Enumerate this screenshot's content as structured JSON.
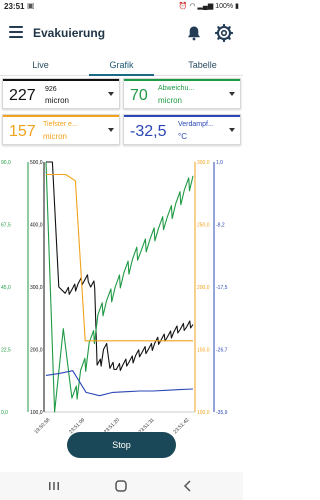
{
  "status": {
    "time": "23:51",
    "battery": "100%",
    "notification_icon": "image-icon"
  },
  "appbar": {
    "title": "Evakuierung"
  },
  "tabs": [
    {
      "label": "Live",
      "active": false
    },
    {
      "label": "Grafik",
      "active": true
    },
    {
      "label": "Tabelle",
      "active": false
    }
  ],
  "cards": [
    {
      "value": "227",
      "sup": "926",
      "unit": "micron",
      "label": "",
      "color": "#111111"
    },
    {
      "value": "70",
      "sup": "",
      "unit": "micron",
      "label": "Abweichu...",
      "color": "#1f9a44"
    },
    {
      "value": "157",
      "sup": "",
      "unit": "micron",
      "label": "Tiefster e...",
      "color": "#f2a21d"
    },
    {
      "value": "-32,5",
      "sup": "",
      "unit": "°C",
      "label": "Verdampf...",
      "color": "#2a47b5"
    }
  ],
  "stop_button": {
    "label": "Stop"
  },
  "chart_data": {
    "type": "line",
    "x": [
      "19:50:58",
      "23:51:09",
      "23:51:20",
      "23:51:31",
      "23:51:42"
    ],
    "axes": {
      "left_green": {
        "ticks": [
          "90,0",
          "67,5",
          "45,0",
          "22,5",
          "0,0"
        ],
        "range": [
          0,
          90
        ],
        "color": "#1f9a44"
      },
      "left_black": {
        "ticks": [
          "500,0",
          "400,0",
          "300,0",
          "200,0",
          "100,0"
        ],
        "range": [
          100,
          500
        ],
        "color": "#111111"
      },
      "right_orange": {
        "ticks": [
          "300,0",
          "250,0",
          "200,0",
          "150,0",
          "100,0"
        ],
        "range": [
          100,
          300
        ],
        "color": "#f2a21d"
      },
      "right_blue": {
        "ticks": [
          "1,0",
          "-8,2",
          "-17,5",
          "-26,7",
          "-35,9"
        ],
        "range": [
          -35.9,
          1.0
        ],
        "color": "#2a47b5"
      }
    },
    "series": [
      {
        "name": "",
        "axis": "left_black",
        "color": "#111111",
        "values": [
          500,
          500,
          300,
          290,
          295,
          305,
          310,
          300,
          175,
          200,
          170,
          168,
          175,
          180,
          190,
          195,
          200,
          210,
          215,
          220,
          228,
          232,
          236,
          240
        ]
      },
      {
        "name": "",
        "axis": "left_green",
        "color": "#1f9a44",
        "values": [
          90,
          0,
          30,
          5,
          15,
          25,
          35,
          40,
          45,
          50,
          55,
          58,
          62,
          66,
          70,
          75,
          80,
          85
        ]
      },
      {
        "name": "",
        "axis": "right_orange",
        "color": "#f2a21d",
        "values": [
          290,
          290,
          290,
          285,
          157,
          157,
          157,
          157,
          157,
          157,
          157,
          157,
          157,
          157,
          157,
          157
        ]
      },
      {
        "name": "",
        "axis": "right_blue",
        "color": "#2a47b5",
        "values": [
          -30.5,
          -30.2,
          -29.8,
          -33.0,
          -33.5,
          -33.0,
          -32.9,
          -32.8,
          -32.8,
          -32.7,
          -32.6,
          -32.5
        ]
      }
    ]
  }
}
